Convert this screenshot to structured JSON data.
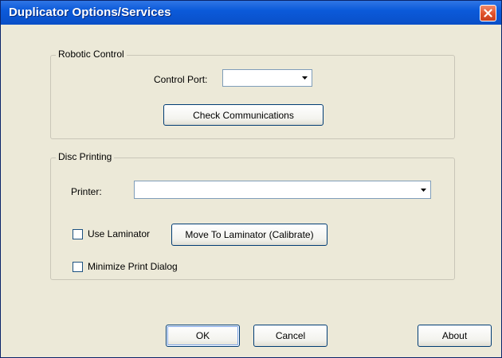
{
  "window": {
    "title": "Duplicator Options/Services"
  },
  "robotic_control": {
    "legend": "Robotic Control",
    "control_port_label": "Control Port:",
    "control_port_value": "",
    "check_button": "Check Communications"
  },
  "disc_printing": {
    "legend": "Disc Printing",
    "printer_label": "Printer:",
    "printer_value": "",
    "use_laminator_label": "Use Laminator",
    "use_laminator_checked": false,
    "move_button": "Move To Laminator (Calibrate)",
    "minimize_label": "Minimize Print Dialog",
    "minimize_checked": false
  },
  "footer": {
    "ok": "OK",
    "cancel": "Cancel",
    "about": "About"
  },
  "icons": {
    "close": "close-icon",
    "dropdown": "chevron-down-icon"
  },
  "colors": {
    "titlebar": "#0b5ada",
    "close": "#e0512a",
    "dialog_bg": "#ece9d8"
  }
}
